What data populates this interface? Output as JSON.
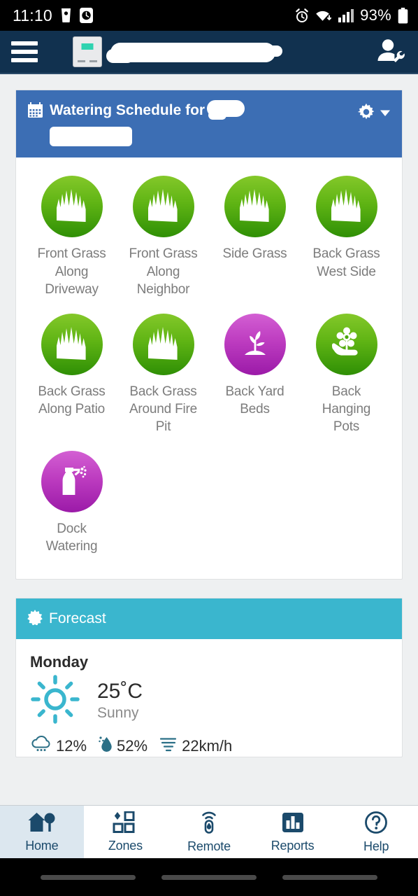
{
  "status_bar": {
    "time": "11:10",
    "battery_text": "93%",
    "icons": [
      "coffee-cup-icon",
      "clock-icon",
      "alarm-icon",
      "wifi-icon",
      "signal-icon",
      "battery-icon"
    ]
  },
  "app_bar": {
    "menu_icon": "hamburger-menu-icon",
    "device_thumbnail": "controller-device-thumbnail",
    "title": "",
    "title_redacted": true,
    "user_icon": "user-settings-icon"
  },
  "schedule_card": {
    "calendar_icon": "calendar-icon",
    "title": "Watering Schedule for",
    "name_redacted": true,
    "settings_icon": "gear-icon",
    "dropdown_icon": "chevron-down-icon",
    "zones": [
      {
        "label": "Front Grass Along Driveway",
        "icon": "grass-icon",
        "color": "green"
      },
      {
        "label": "Front Grass Along Neighbor",
        "icon": "grass-icon",
        "color": "green"
      },
      {
        "label": "Side Grass",
        "icon": "grass-icon",
        "color": "green"
      },
      {
        "label": "Back Grass West Side",
        "icon": "grass-icon",
        "color": "green"
      },
      {
        "label": "Back Grass Along Patio",
        "icon": "grass-icon",
        "color": "green"
      },
      {
        "label": "Back Grass Around Fire Pit",
        "icon": "grass-icon",
        "color": "green"
      },
      {
        "label": "Back Yard Beds",
        "icon": "seedling-icon",
        "color": "purple"
      },
      {
        "label": "Back Hanging Pots",
        "icon": "flower-in-hand-icon",
        "color": "green"
      },
      {
        "label": "Dock Watering",
        "icon": "spray-bottle-icon",
        "color": "purple"
      }
    ]
  },
  "forecast_card": {
    "sun_icon": "sun-burst-icon",
    "title": "Forecast",
    "day": "Monday",
    "weather_icon": "sun-icon",
    "temperature": "25˚C",
    "condition": "Sunny",
    "stats": [
      {
        "icon": "rain-cloud-icon",
        "value": "12%"
      },
      {
        "icon": "humidity-drop-icon",
        "value": "52%"
      },
      {
        "icon": "wind-icon",
        "value": "22km/h"
      }
    ]
  },
  "bottom_nav": {
    "items": [
      {
        "label": "Home",
        "icon": "home-tree-icon",
        "active": true
      },
      {
        "label": "Zones",
        "icon": "zones-grid-icon",
        "active": false
      },
      {
        "label": "Remote",
        "icon": "remote-signal-icon",
        "active": false
      },
      {
        "label": "Reports",
        "icon": "bar-chart-icon",
        "active": false
      },
      {
        "label": "Help",
        "icon": "question-circle-icon",
        "active": false
      }
    ]
  },
  "colors": {
    "status_bar_bg": "#000000",
    "app_bar_bg": "#11314f",
    "schedule_header_bg": "#3c6eb4",
    "forecast_header_bg": "#3ab6ce",
    "nav_accent": "#1b4a6b",
    "nav_active_bg": "#dce7ef",
    "zone_green_top": "#84c82a",
    "zone_green_bottom": "#2f8f05",
    "zone_purple_top": "#d35fd3",
    "zone_purple_bottom": "#9b1aa8",
    "page_bg": "#eef0f1"
  }
}
